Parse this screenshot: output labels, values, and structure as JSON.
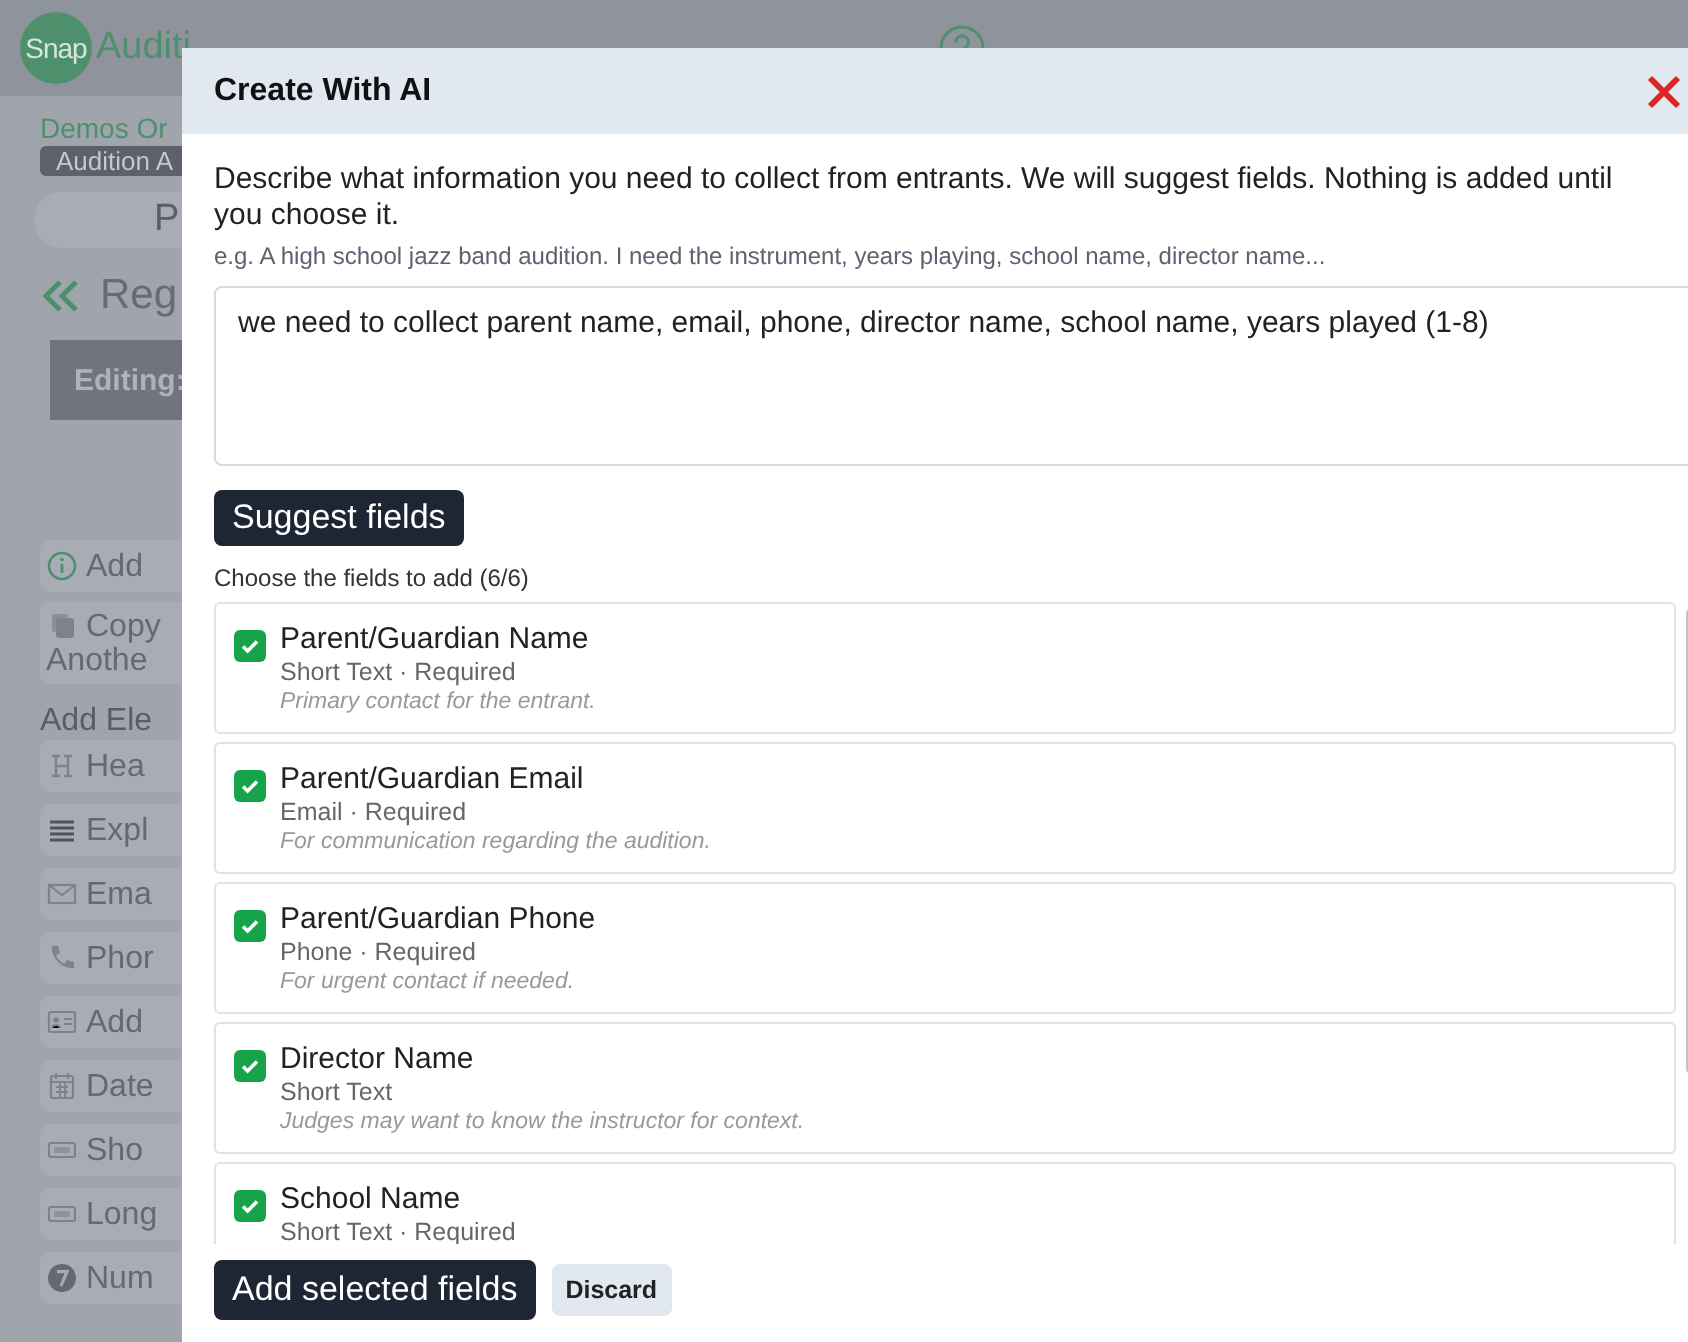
{
  "header": {
    "logo": "Snap",
    "brand": "Auditi"
  },
  "sidebar": {
    "org": "Demos Or",
    "badge": "Audition A",
    "tab": "P",
    "heading": "Reg",
    "editing": "Editing:",
    "actions": [
      {
        "kind": "info",
        "label": "Add"
      },
      {
        "kind": "copy",
        "label": "Copy\nAnothe"
      }
    ],
    "section": "Add Ele",
    "elements": [
      {
        "kind": "heading",
        "label": "Hea"
      },
      {
        "kind": "paragraph",
        "label": "Expl"
      },
      {
        "kind": "email",
        "label": "Ema"
      },
      {
        "kind": "phone",
        "label": "Phor"
      },
      {
        "kind": "address",
        "label": "Add"
      },
      {
        "kind": "date",
        "label": "Date"
      },
      {
        "kind": "text",
        "label": "Sho"
      },
      {
        "kind": "text",
        "label": "Long"
      },
      {
        "kind": "number",
        "label": "Num"
      }
    ]
  },
  "dialog": {
    "title": "Create With AI",
    "description": "Describe what information you need to collect from entrants. We will suggest fields. Nothing is added until you choose it.",
    "hint": "e.g. A high school jazz band audition. I need the instrument, years playing, school name, director name...",
    "prompt": "we need to collect parent name, email, phone, director name, school name, years played (1-8)",
    "suggest_button": "Suggest fields",
    "choose_label": "Choose the fields to add (6/6)",
    "fields": [
      {
        "name": "Parent/Guardian Name",
        "meta": "Short Text · Required",
        "note": "Primary contact for the entrant.",
        "checked": true
      },
      {
        "name": "Parent/Guardian Email",
        "meta": "Email · Required",
        "note": "For communication regarding the audition.",
        "checked": true
      },
      {
        "name": "Parent/Guardian Phone",
        "meta": "Phone · Required",
        "note": "For urgent contact if needed.",
        "checked": true
      },
      {
        "name": "Director Name",
        "meta": "Short Text",
        "note": "Judges may want to know the instructor for context.",
        "checked": true
      },
      {
        "name": "School Name",
        "meta": "Short Text · Required",
        "checked": true
      }
    ],
    "add_button": "Add selected fields",
    "discard_button": "Discard"
  }
}
